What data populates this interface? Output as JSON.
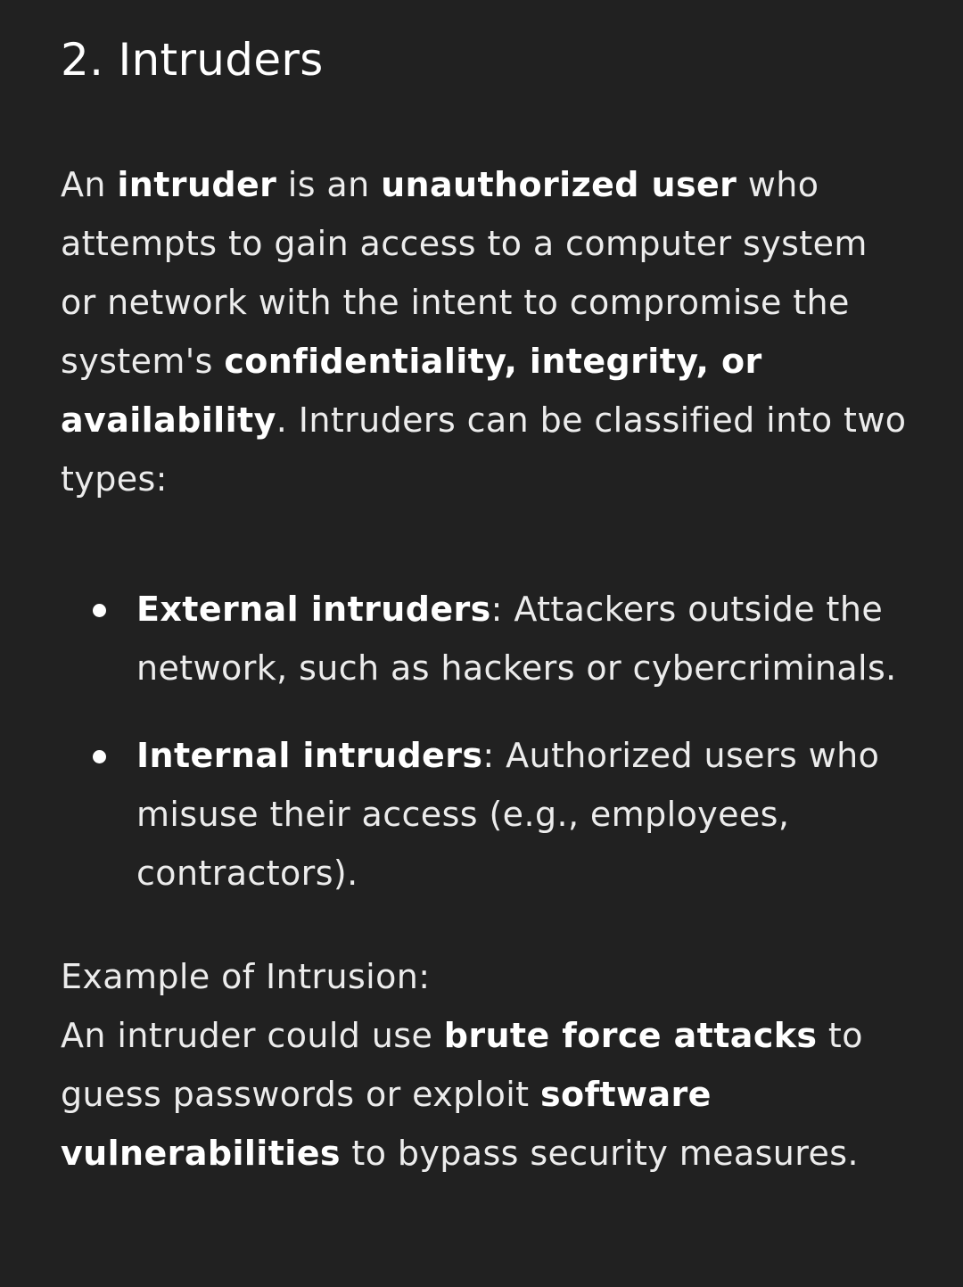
{
  "heading": "2. Intruders",
  "intro": {
    "t1": "An ",
    "b1": "intruder",
    "t2": " is an ",
    "b2": "unauthorized user",
    "t3": " who attempts to gain access to a computer system or network with the intent to compromise the system's ",
    "b3": "confidentiality, integrity, or availability",
    "t4": ". Intruders can be classified into two types:"
  },
  "list": [
    {
      "term": "External intruders",
      "desc": ": Attackers outside the network, such as hackers or cybercriminals."
    },
    {
      "term": "Internal intruders",
      "desc": ": Authorized users who misuse their access (e.g., employees, contractors)."
    }
  ],
  "example": {
    "label": "Example of Intrusion:",
    "t1": "An intruder could use ",
    "b1": "brute force attacks",
    "t2": " to guess passwords or exploit ",
    "b2": "software vulnerabilities",
    "t3": " to bypass security measures."
  }
}
